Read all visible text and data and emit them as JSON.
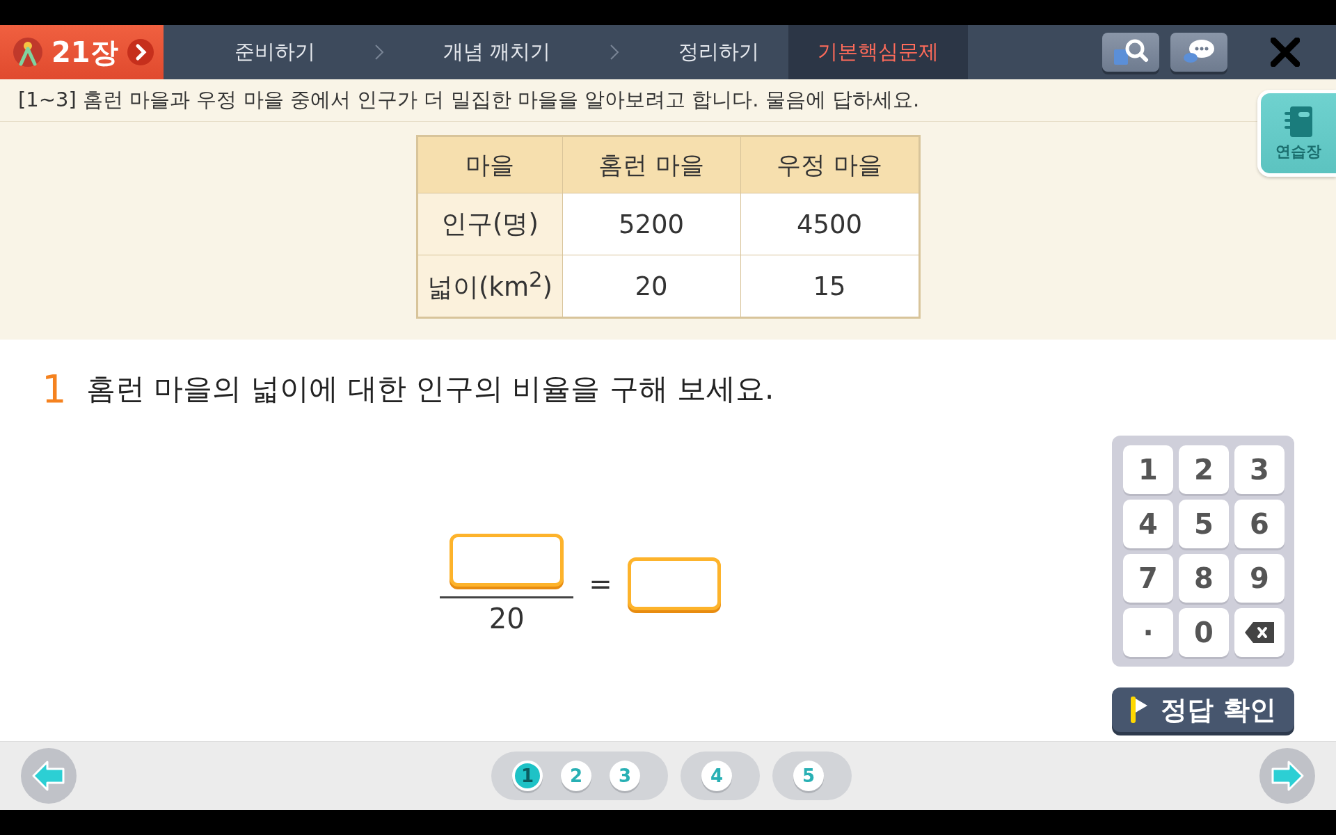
{
  "header": {
    "chapter": "21장",
    "steps": [
      {
        "label": "준비하기",
        "selected": false
      },
      {
        "label": "개념 깨치기",
        "selected": false
      },
      {
        "label": "정리하기",
        "selected": false
      },
      {
        "label": "기본핵심문제",
        "selected": true
      }
    ]
  },
  "instruction": "[1~3] 홈런 마을과 우정 마을 중에서 인구가 더 밀집한 마을을 알아보려고 합니다. 물음에 답하세요.",
  "side_tab": {
    "label": "연습장"
  },
  "table": {
    "columns": [
      "마을",
      "홈런 마을",
      "우정 마을"
    ],
    "rows": [
      [
        "인구(명)",
        "5200",
        "4500"
      ],
      [
        "넓이(km$^{2}$)",
        "20",
        "15"
      ]
    ]
  },
  "question": {
    "number": "1",
    "text": "홈런 마을의 넓이에 대한 인구의 비율을 구해 보세요.",
    "denominator": "20",
    "equals": "="
  },
  "keypad": [
    {
      "kind": "key",
      "label": "1"
    },
    {
      "kind": "key",
      "label": "2"
    },
    {
      "kind": "key",
      "label": "3"
    },
    {
      "kind": "key",
      "label": "4"
    },
    {
      "kind": "key",
      "label": "5"
    },
    {
      "kind": "key",
      "label": "6"
    },
    {
      "kind": "key",
      "label": "7"
    },
    {
      "kind": "key",
      "label": "8"
    },
    {
      "kind": "key",
      "label": "9"
    },
    {
      "kind": "key",
      "label": "·"
    },
    {
      "kind": "key",
      "label": "0"
    },
    {
      "kind": "backspace"
    }
  ],
  "check_button": "정답 확인",
  "pagination": [
    [
      {
        "label": "1",
        "selected": true
      },
      {
        "label": "2",
        "selected": false
      },
      {
        "label": "3",
        "selected": false
      }
    ],
    [
      {
        "label": "4",
        "selected": false
      }
    ],
    [
      {
        "label": "5",
        "selected": false
      }
    ]
  ]
}
